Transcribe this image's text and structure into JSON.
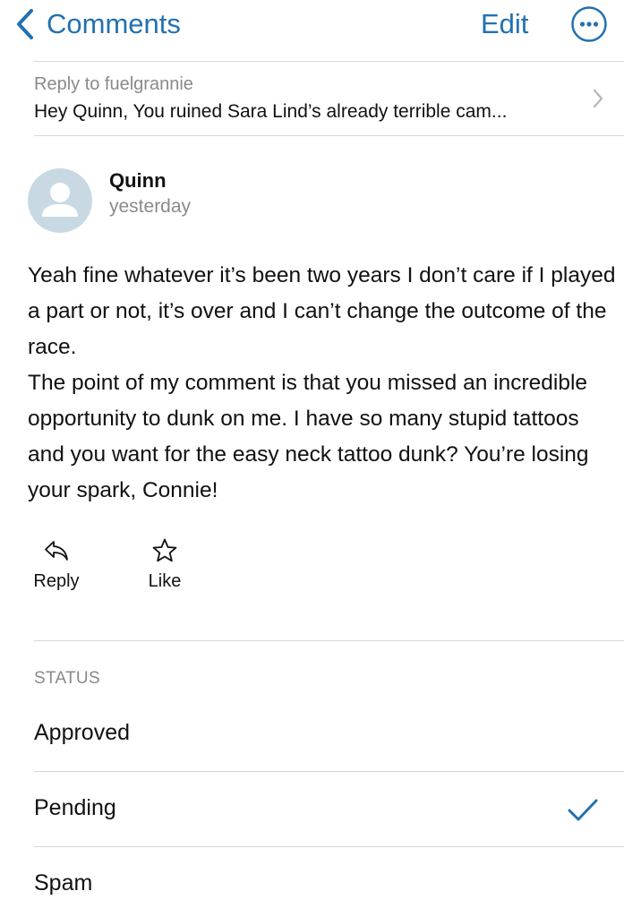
{
  "nav": {
    "back_label": "Comments",
    "edit_label": "Edit",
    "accent_color": "#2271b1"
  },
  "reply_to": {
    "label": "Reply to fuelgrannie",
    "excerpt": "Hey Quinn, You ruined Sara Lind’s already terrible cam..."
  },
  "author": {
    "name": "Quinn",
    "time": "yesterday"
  },
  "comment": {
    "paragraphs": [
      "Yeah fine whatever it’s been two years I don’t care if I played a part or not, it’s over and I can’t change the outcome of the race.",
      "The point of my comment is that you missed an incredible opportunity to dunk on me. I have so many stupid tattoos and you want for the easy neck tattoo dunk? You’re losing your spark, Connie!"
    ]
  },
  "actions": {
    "reply_label": "Reply",
    "like_label": "Like"
  },
  "status": {
    "header": "STATUS",
    "options": [
      {
        "label": "Approved",
        "selected": false
      },
      {
        "label": "Pending",
        "selected": true
      },
      {
        "label": "Spam",
        "selected": false
      }
    ]
  }
}
